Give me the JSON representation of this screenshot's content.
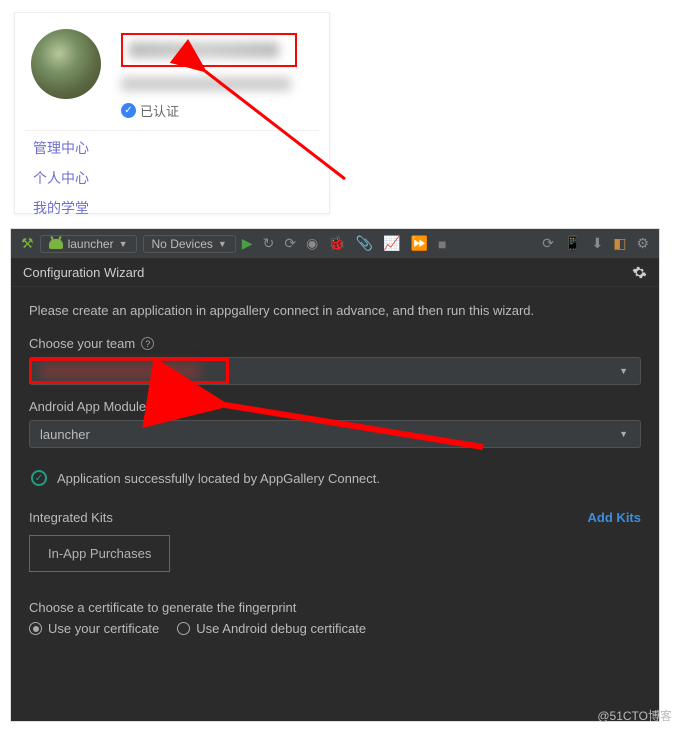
{
  "profile": {
    "verified_label": "已认证",
    "links": {
      "manage_center": "管理中心",
      "personal_center": "个人中心",
      "my_learning": "我的学堂"
    }
  },
  "ide": {
    "toolbar": {
      "run_config_label": "launcher",
      "device_label": "No Devices"
    },
    "wizard": {
      "title": "Configuration Wizard",
      "intro": "Please create an application in appgallery connect in advance, and then run this wizard.",
      "team_label": "Choose your team",
      "module_label": "Android App Module",
      "module_value": "launcher",
      "status_text": "Application successfully located by AppGallery Connect.",
      "kits_label": "Integrated Kits",
      "add_kits_label": "Add Kits",
      "kit_chip_label": "In-App Purchases",
      "cert_label": "Choose a certificate to generate the fingerprint",
      "radio_use_your": "Use your certificate",
      "radio_use_debug": "Use Android debug certificate"
    }
  },
  "watermark": "@51CTO博客"
}
